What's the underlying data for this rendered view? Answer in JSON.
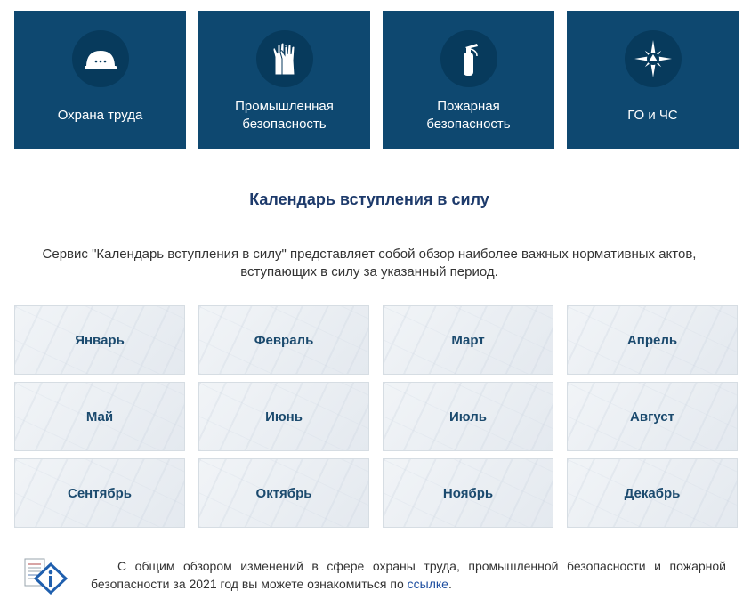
{
  "tiles": [
    {
      "label_lines": [
        "Охрана труда"
      ],
      "icon": "hard-hat-icon"
    },
    {
      "label_lines": [
        "Промышленная",
        "безопасность"
      ],
      "icon": "gloves-icon"
    },
    {
      "label_lines": [
        "Пожарная",
        "безопасность"
      ],
      "icon": "fire-extinguisher-icon"
    },
    {
      "label_lines": [
        "ГО и ЧС"
      ],
      "icon": "civil-defense-star-icon"
    }
  ],
  "section_title": "Календарь вступления в силу",
  "intro_text": "Сервис \"Календарь вступления в силу\" представляет собой обзор наиболее важных нормативных актов, вступающих в силу за указанный период.",
  "months": [
    "Январь",
    "Февраль",
    "Март",
    "Апрель",
    "Май",
    "Июнь",
    "Июль",
    "Август",
    "Сентябрь",
    "Октябрь",
    "Ноябрь",
    "Декабрь"
  ],
  "note": {
    "text": "С общим обзором изменений в сфере охраны труда, промышленной безопасности и пожарной безопасности за 2021 год вы можете ознакомиться по ",
    "link_label": "ссылке",
    "end": ".",
    "icon": "info-document-icon"
  },
  "colors": {
    "tile_bg": "#0e4870",
    "title": "#1d3a6b",
    "month_text": "#1b4a6e",
    "link": "#1f4fa0"
  }
}
